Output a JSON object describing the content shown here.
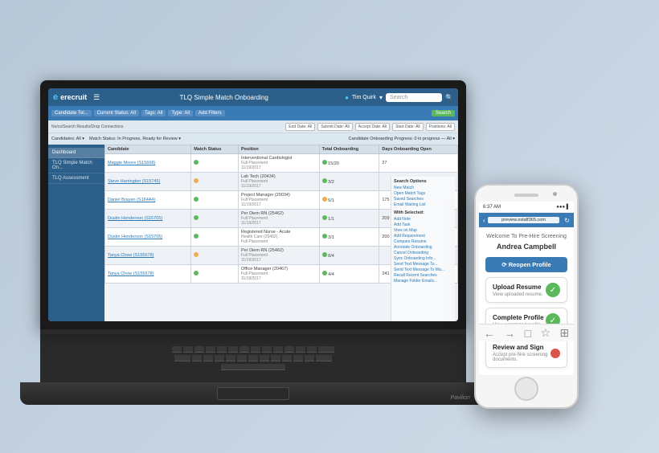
{
  "scene": {
    "background": "#c8d4e0"
  },
  "laptop": {
    "brand": "Pavilion",
    "app": {
      "logo": "erecruit",
      "title": "TLQ Simple Match Onboarding",
      "user": "Tim Quirk",
      "search_placeholder": "Search...",
      "nav": {
        "items": [
          "Dashboard",
          "TLQ Simple Match On...",
          "TLQ Assessment"
        ]
      },
      "toolbar": {
        "filters": [
          "Candidate Tel...",
          "Current Status: All",
          "Tags: All",
          "Type: All",
          "Add Filters",
          "End Date: All",
          "Submit Date: All",
          "Accept Date: All",
          "Start Date: All",
          "Positions: All"
        ],
        "search_btn": "Search"
      },
      "table": {
        "headers": [
          "Candidate",
          "Match Status",
          "Position",
          "Total Onboarding",
          "Days Onboarding Open"
        ],
        "rows": [
          {
            "name": "Maggie Moore (S15668)",
            "status": "In Progress",
            "position": "Interventional Cardiologist",
            "type": "Full Placement",
            "total": "15/20",
            "days_open": "27"
          },
          {
            "name": "Steve Harrington (S15745)",
            "status": "In Progress",
            "position": "Lab Tech (20434)",
            "type": "Full Placement",
            "total": "3/2",
            "days_open": ""
          },
          {
            "name": "Daniel Brayan (S164A4)",
            "status": "In Progress",
            "position": "Project Manager (20034)",
            "type": "Full Placement",
            "total": "5/1",
            "days_open": "175"
          },
          {
            "name": "Dustin Henderson (S15705)",
            "status": "In Progress",
            "position": "Per Diem RN (25462)",
            "type": "Full Placement",
            "total": "1/1",
            "days_open": "209"
          },
          {
            "name": "Dustin Henderson (S15705)",
            "status": "In Progress",
            "position": "Registered Nurse - Acute Health Care (20402)",
            "type": "Full Placement",
            "total": "3/1",
            "days_open": "200"
          },
          {
            "name": "Tanya Chow (S155678)",
            "status": "In Progress",
            "position": "Per Diem RN (25462)",
            "type": "Full Placement",
            "total": "8/4",
            "days_open": ""
          },
          {
            "name": "Tanya Chow (S155678)",
            "status": "In Progress",
            "position": "Office Manager (20467)",
            "type": "Full Placement",
            "total": "4/4",
            "days_open": "241"
          }
        ]
      },
      "right_panel": {
        "title": "Search Options",
        "actions": [
          "New Match",
          "Open Match Tags",
          "Saved Searches",
          "Email Waiting List"
        ],
        "section2": "With Selected:",
        "with_selected": [
          "Add Note",
          "Add Task",
          "View on Map",
          "Add Requirement",
          "Compare Resume",
          "Annotate Onboarding",
          "Cancel Onboarding",
          "Sync Onboarding Info...",
          "Send Text Message To...",
          "Send Text Message To Ma...",
          "Recall Recent Searches",
          "Manage Folder Emails..."
        ]
      }
    }
  },
  "phone": {
    "status_bar": {
      "time": "6:37 AM",
      "signal": "●●●",
      "battery": "■"
    },
    "url": "preview.estaff365.com",
    "welcome_text": "Welcome To Pre-Hire Screening",
    "candidate_name": "Andrea Campbell",
    "reopen_btn": "⟳ Reopen Profile",
    "steps": [
      {
        "title": "Upload Resume",
        "subtitle": "View uploaded resume.",
        "status": "complete"
      },
      {
        "title": "Complete Profile",
        "subtitle": "View completed profile.",
        "status": "complete"
      },
      {
        "title": "Review and Sign",
        "subtitle": "Accept pre-hire screening documents.",
        "status": "pending"
      }
    ],
    "bottom_nav": [
      "←",
      "→",
      "□",
      "↑",
      "□"
    ]
  }
}
